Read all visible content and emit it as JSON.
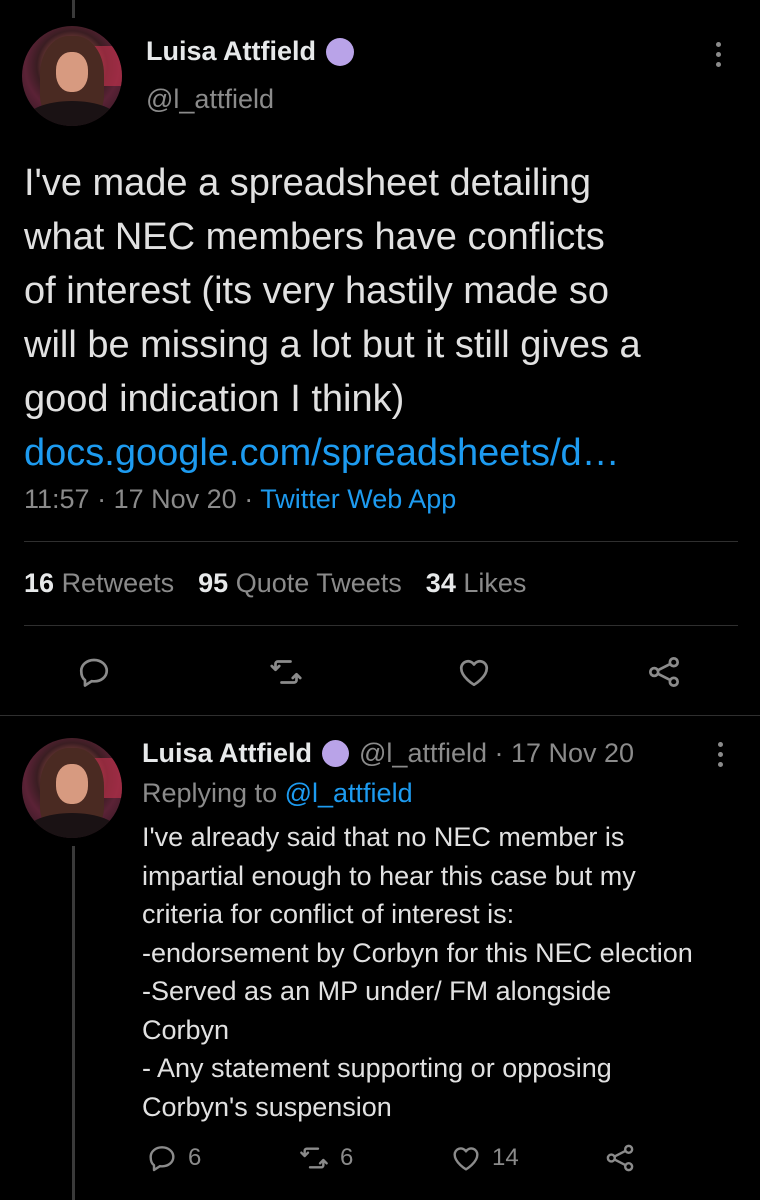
{
  "main_tweet": {
    "display_name": "Luisa Attfield",
    "handle": "@l_attfield",
    "text_lines": [
      "I've made a spreadsheet detailing",
      "what NEC members have conflicts",
      "of interest (its very hastily made so",
      "will be missing a lot but it still gives a",
      "good indication I think)"
    ],
    "link": "docs.google.com/spreadsheets/d…",
    "time": "11:57",
    "date": "17 Nov 20",
    "source": "Twitter Web App",
    "separator": "·",
    "stats": {
      "retweets_count": "16",
      "retweets_label": "Retweets",
      "quotes_count": "95",
      "quotes_label": "Quote Tweets",
      "likes_count": "34",
      "likes_label": "Likes"
    }
  },
  "reply_tweet": {
    "display_name": "Luisa Attfield",
    "handle_date": "@l_attfield · 17 Nov 20",
    "replying_to_label": "Replying to",
    "replying_to_handle": "@l_attfield",
    "text_lines": [
      "I've already said that no NEC member is",
      "impartial enough to hear this case but my",
      "criteria for conflict of interest is:",
      "-endorsement by Corbyn for this NEC election",
      "-Served as an MP under/ FM alongside",
      "Corbyn",
      "- Any statement supporting or opposing",
      "Corbyn's suspension"
    ],
    "actions": {
      "reply_count": "6",
      "retweet_count": "6",
      "like_count": "14"
    }
  },
  "colors": {
    "background": "#000000",
    "link": "#1d9bf0",
    "muted": "#8b8b8b",
    "verified_badge": "#b9a3e8"
  },
  "icons": [
    "reply-icon",
    "retweet-icon",
    "like-icon",
    "share-icon",
    "more-icon",
    "verified-icon"
  ]
}
